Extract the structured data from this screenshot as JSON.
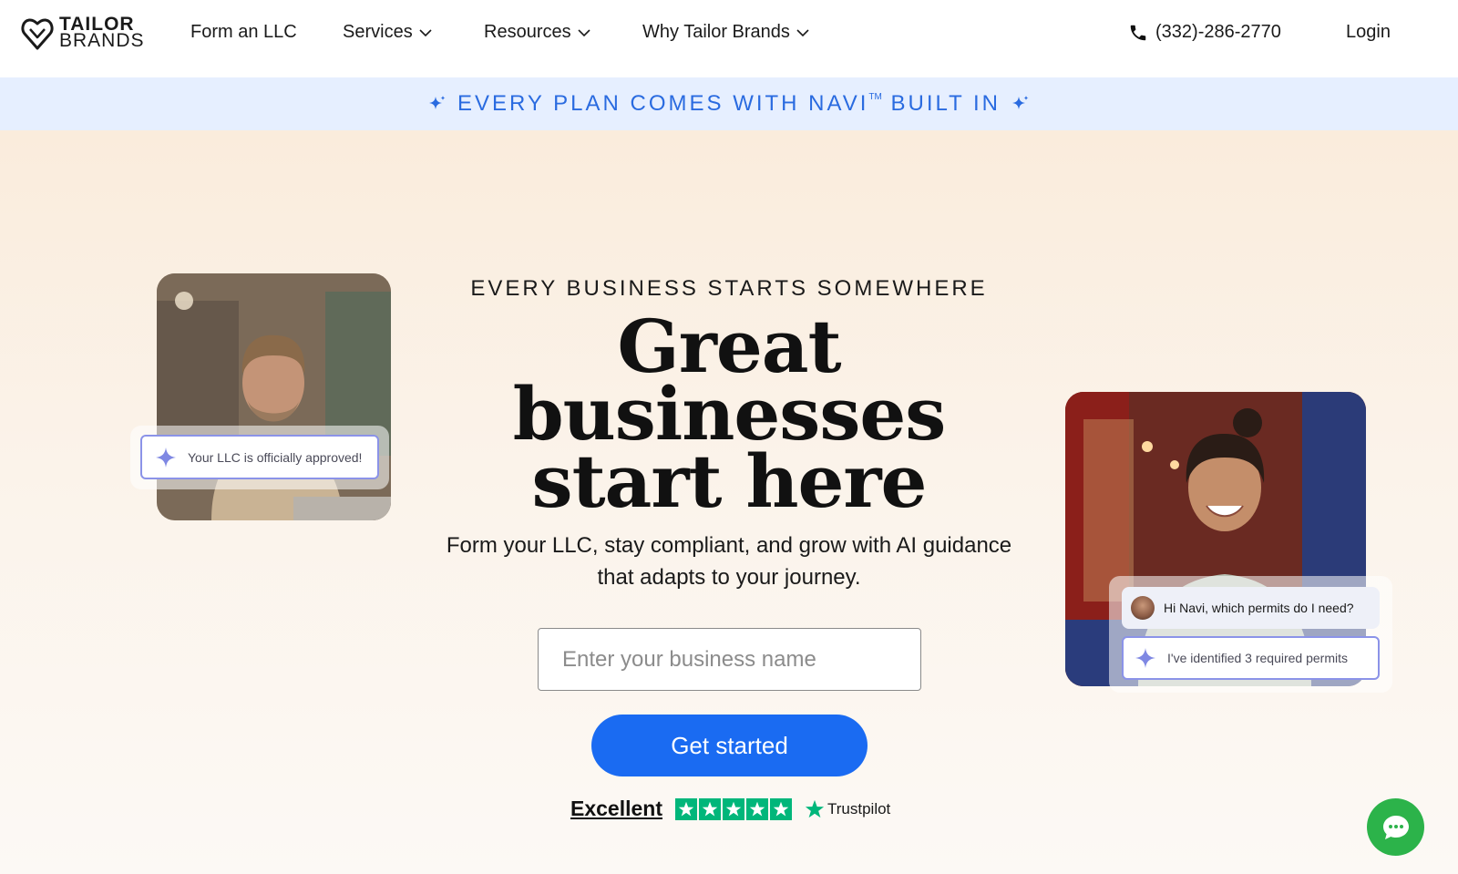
{
  "header": {
    "logo_line1": "TAILOR",
    "logo_line2": "BRANDS",
    "nav": {
      "form_llc": "Form an LLC",
      "services": "Services",
      "resources": "Resources",
      "why": "Why Tailor Brands"
    },
    "phone": "(332)-286-2770",
    "login": "Login"
  },
  "banner": {
    "text_before": "EVERY PLAN COMES WITH NAVI",
    "trademark": "TM",
    "text_after": " BUILT IN"
  },
  "hero": {
    "eyebrow": "EVERY BUSINESS STARTS SOMEWHERE",
    "headline_line1": "Great",
    "headline_line2": "businesses",
    "headline_line3": "start here",
    "subhead_line1": "Form your LLC, stay compliant, and grow with AI guidance",
    "subhead_line2": "that adapts to your journey.",
    "input_placeholder": "Enter your business name",
    "cta_label": "Get started",
    "trust_rating": "Excellent",
    "trust_brand": "Trustpilot",
    "trust_stars": 5
  },
  "cards": {
    "left_pill": "Your LLC is officially approved!",
    "chat_question": "Hi Navi, which permits do I need?",
    "chat_answer": "I've identified 3 required permits"
  },
  "colors": {
    "brand_blue": "#1a6bf2",
    "banner_blue": "#2a6be0",
    "banner_bg": "#e6efff",
    "trustpilot_green": "#00b67a",
    "chat_fab_green": "#2cb34a",
    "navi_purple": "#8b93e8"
  },
  "icons": {
    "logo": "heart-shield-logo-icon",
    "phone": "phone-icon",
    "sparkle": "sparkle-icon",
    "chevron": "chevron-down-icon",
    "chat": "chat-bubble-icon"
  }
}
